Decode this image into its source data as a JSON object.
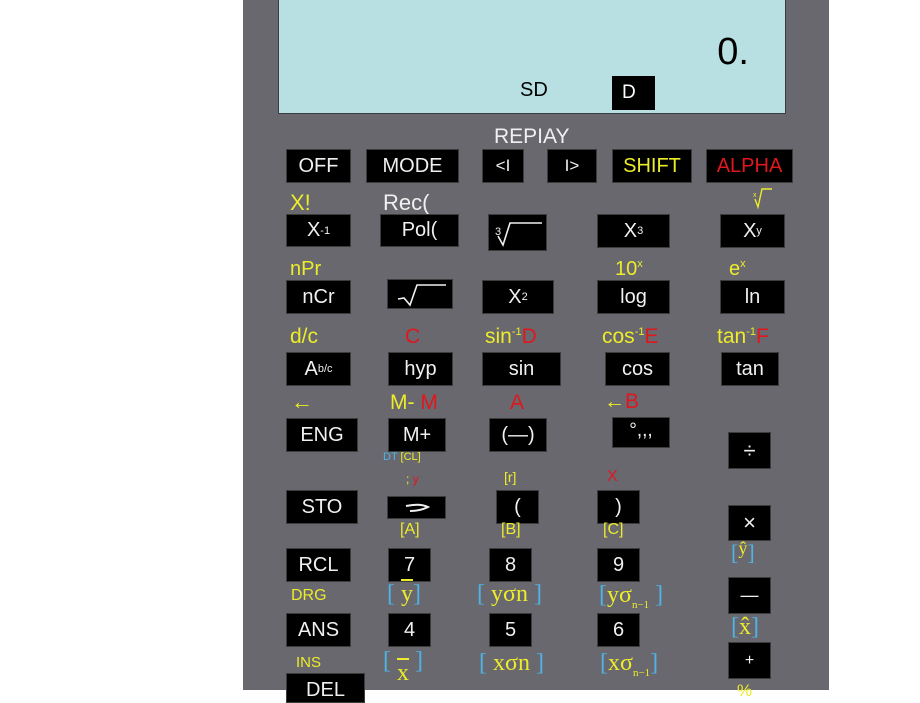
{
  "display": {
    "value": "0.",
    "mode_indicator": "SD",
    "angle_indicator": "D"
  },
  "replay_label": "REPIAY",
  "top_row": {
    "off": "OFF",
    "mode": "MODE",
    "left": "<I",
    "right": "I>",
    "shift": "SHIFT",
    "alpha": "ALPHA"
  },
  "row1": {
    "labels": {
      "factorial": "X!",
      "rec": "Rec(",
      "xroot": "x√"
    },
    "keys": {
      "inverse": "X",
      "inverse_sup": "-1",
      "pol": "Pol(",
      "cube_root": "3√",
      "cube": "X",
      "cube_sup": "3",
      "power": "X",
      "power_sup": "y"
    }
  },
  "row2": {
    "labels": {
      "npr": "nPr",
      "ten_pow": "10",
      "ten_pow_sup": "x",
      "e_pow": "e",
      "e_pow_sup": "x"
    },
    "keys": {
      "ncr": "nCr",
      "sqrt": "√",
      "square": "X",
      "square_sup": "2",
      "log": "log",
      "ln": "ln"
    }
  },
  "row3": {
    "labels": {
      "dc": "d/c",
      "c": "C",
      "asin": "sin",
      "asin_sup": "-1",
      "asin_alpha": "D",
      "acos": "cos",
      "acos_sup": "-1",
      "acos_alpha": "E",
      "atan": "tan",
      "atan_sup": "-1",
      "atan_alpha": "F"
    },
    "keys": {
      "frac": "A",
      "frac_sup": "b/c",
      "hyp": "hyp",
      "sin": "sin",
      "cos": "cos",
      "tan": "tan"
    }
  },
  "row4": {
    "labels": {
      "back_arrow": "←",
      "m_minus": "M-",
      "m_alpha": "M",
      "a": "A",
      "b_arrow": "←",
      "b": "B"
    },
    "keys": {
      "eng": "ENG",
      "m_plus": "M+",
      "negative": "(—)",
      "dms": "°,,,",
      "divide": "÷"
    },
    "sub_labels": {
      "dt": "DT",
      "cl": "[CL]"
    }
  },
  "row5": {
    "labels": {
      "semicolon": ";",
      "y": "y",
      "r": "[r]",
      "x": "X"
    },
    "keys": {
      "sto": "STO",
      "eng_arrow": "⊃",
      "open_paren": "(",
      "close_paren": ")",
      "multiply": "×"
    },
    "sub_labels": {
      "a": "[A]",
      "b": "[B]",
      "c": "[C]",
      "yhat": "ŷ"
    }
  },
  "row6": {
    "keys": {
      "rcl": "RCL",
      "seven": "7",
      "eight": "8",
      "nine": "9",
      "minus": "—"
    },
    "labels": {
      "drg": "DRG",
      "ybar": "y",
      "yon": "yσn",
      "yon1": "yσ",
      "yon1_sub": "n−1",
      "xhat": "x̂"
    }
  },
  "row7": {
    "keys": {
      "ans": "ANS",
      "four": "4",
      "five": "5",
      "six": "6",
      "plus": "+"
    },
    "labels": {
      "ins": "INS",
      "xbar": "x",
      "xon": "xσn",
      "xon1": "xσ",
      "xon1_sub": "n−1",
      "percent": "%"
    }
  },
  "row8": {
    "keys": {
      "del": "DEL"
    }
  }
}
